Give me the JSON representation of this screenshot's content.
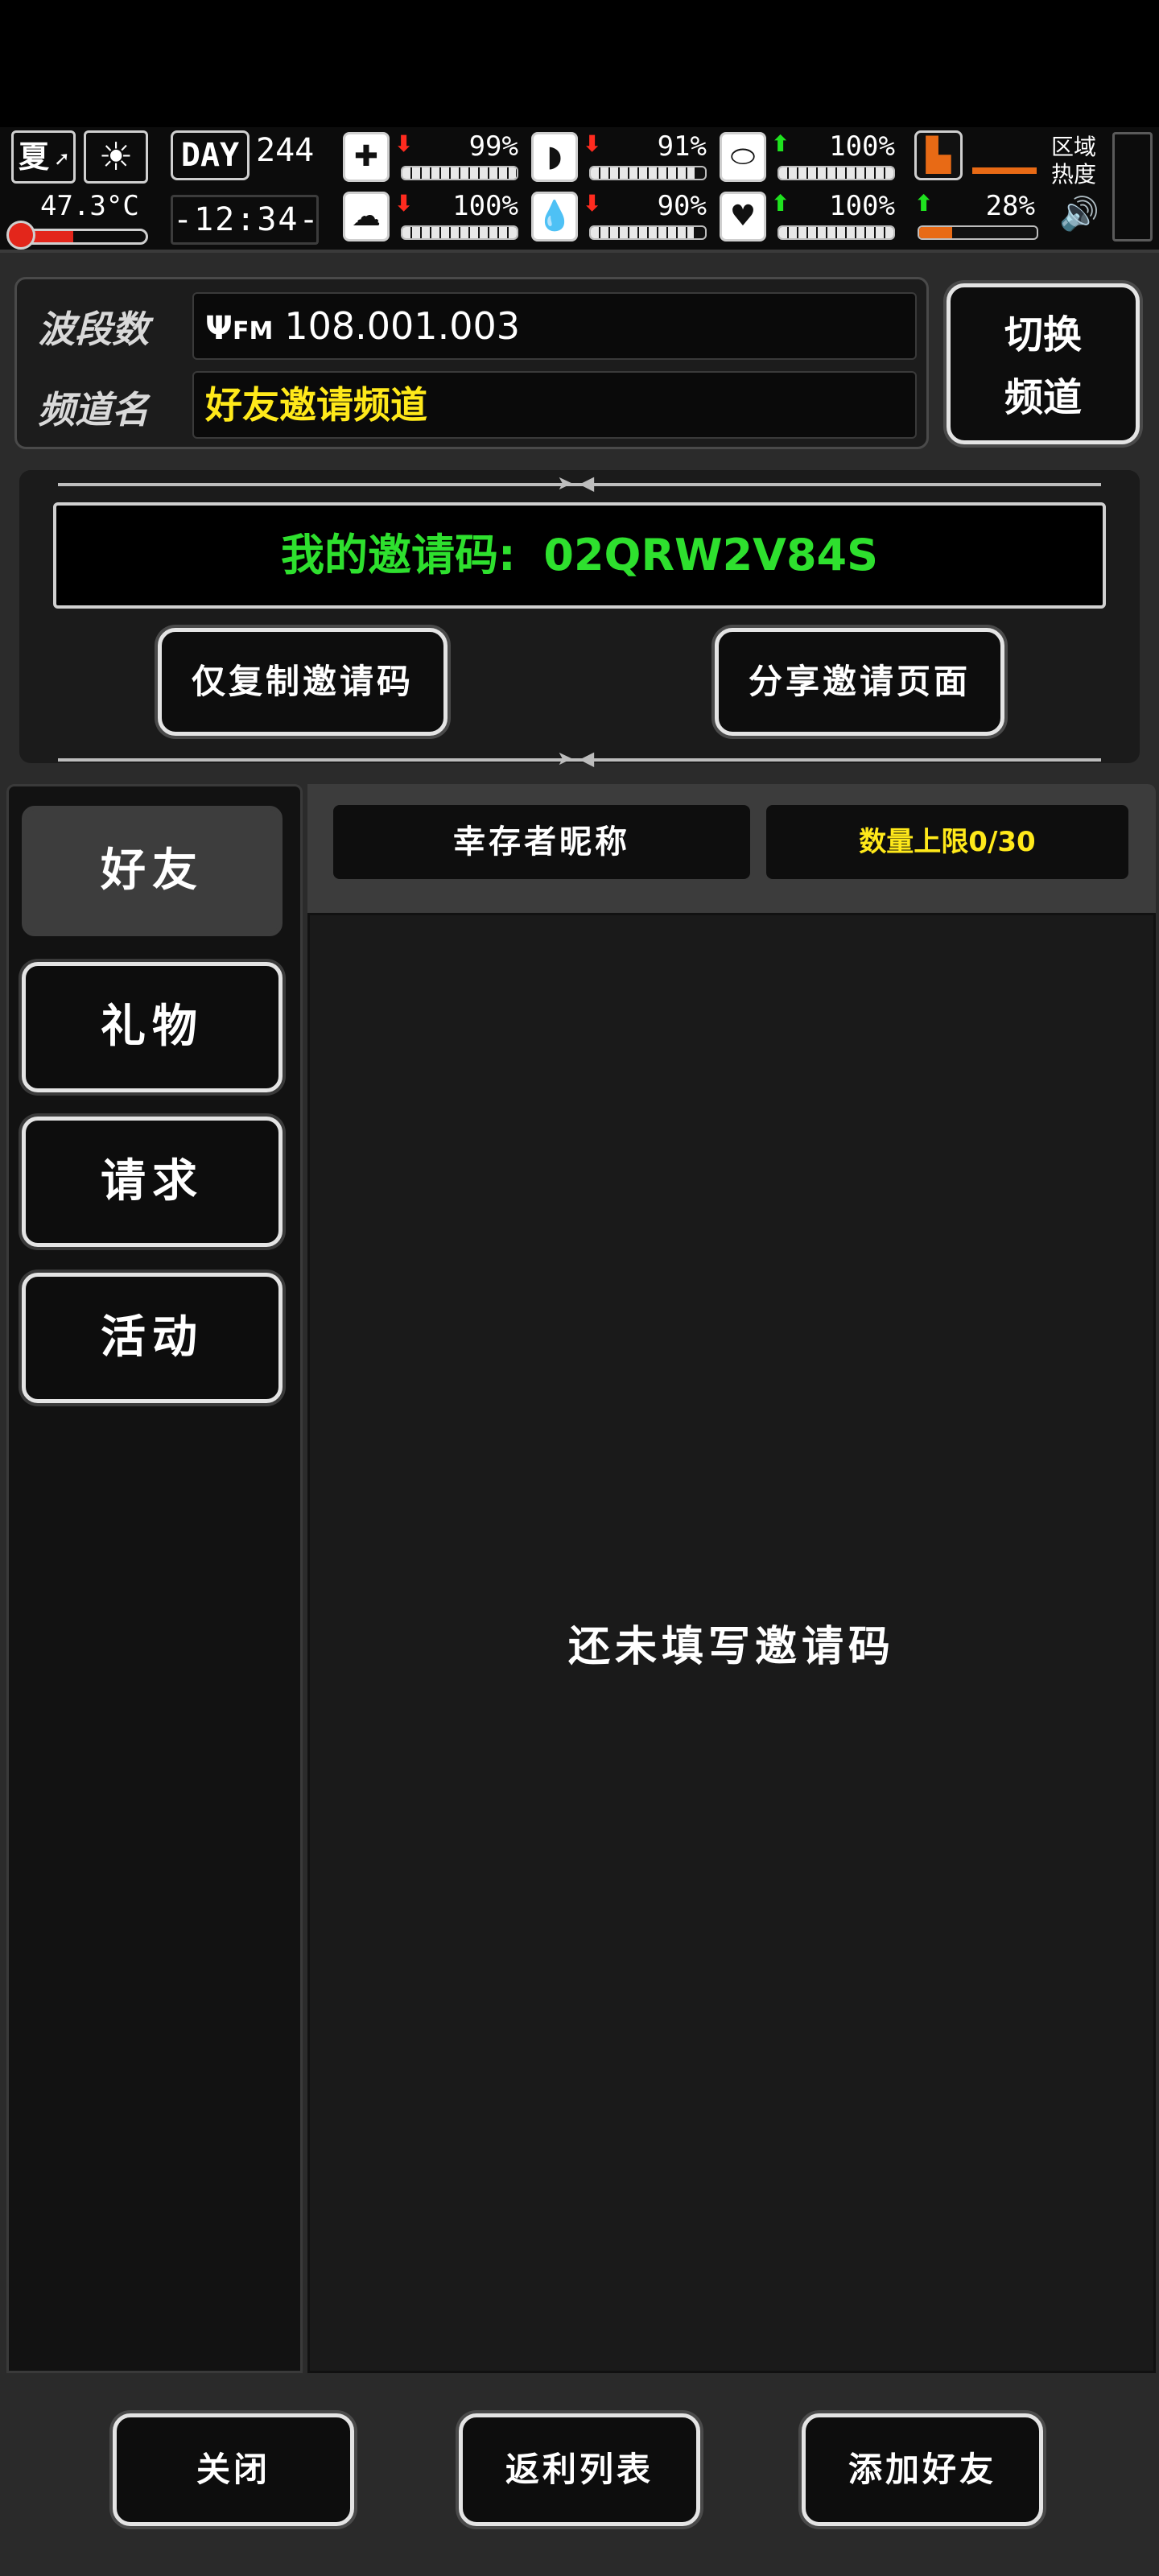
{
  "hud": {
    "season": "夏",
    "temperature": "47.3°C",
    "temperature_level": 0.45,
    "day_label": "DAY",
    "day_number": "244",
    "time": "-12:34-",
    "stats": [
      {
        "name": "health",
        "icon": "medkit-icon",
        "glyph": "✚",
        "trend": "down",
        "arrow": "⬇",
        "value": "99%",
        "level": 0.99
      },
      {
        "name": "hunger",
        "icon": "stomach-icon",
        "glyph": "◗",
        "trend": "down",
        "arrow": "⬇",
        "value": "91%",
        "level": 0.91
      },
      {
        "name": "energy",
        "icon": "pill-icon",
        "glyph": "⬭",
        "trend": "up",
        "arrow": "⬆",
        "value": "100%",
        "level": 1.0
      },
      {
        "name": "sanity",
        "icon": "brain-icon",
        "glyph": "☁",
        "trend": "down",
        "arrow": "⬇",
        "value": "100%",
        "level": 1.0
      },
      {
        "name": "thirst",
        "icon": "water-drop-icon",
        "glyph": "💧",
        "trend": "down",
        "arrow": "⬇",
        "value": "90%",
        "level": 0.9
      },
      {
        "name": "mood",
        "icon": "heart-icon",
        "glyph": "♥",
        "trend": "up",
        "arrow": "⬆",
        "value": "100%",
        "level": 1.0
      }
    ],
    "stamina": {
      "trend": "up",
      "arrow": "⬆",
      "value": "28%",
      "level": 0.28
    },
    "region_label": "区域热度"
  },
  "channel": {
    "band_label": "波段数",
    "band_icon_text": "FM",
    "band_value": "108.001.003",
    "name_label": "频道名",
    "name_value": "好友邀请频道",
    "switch_button": "切换\n频道"
  },
  "invite": {
    "code_label": "我的邀请码:",
    "code_value": "02QRW2V84S",
    "copy_button": "仅复制邀请码",
    "share_button": "分享邀请页面"
  },
  "sidebar": {
    "tabs": [
      {
        "id": "friends",
        "label": "好友",
        "active": true
      },
      {
        "id": "gifts",
        "label": "礼物",
        "active": false
      },
      {
        "id": "requests",
        "label": "请求",
        "active": false
      },
      {
        "id": "events",
        "label": "活动",
        "active": false
      }
    ]
  },
  "list": {
    "col_name": "幸存者昵称",
    "col_limit": "数量上限0/30",
    "empty_message": "还未填写邀请码"
  },
  "footer": {
    "close": "关闭",
    "rebate": "返利列表",
    "add_friend": "添加好友"
  }
}
